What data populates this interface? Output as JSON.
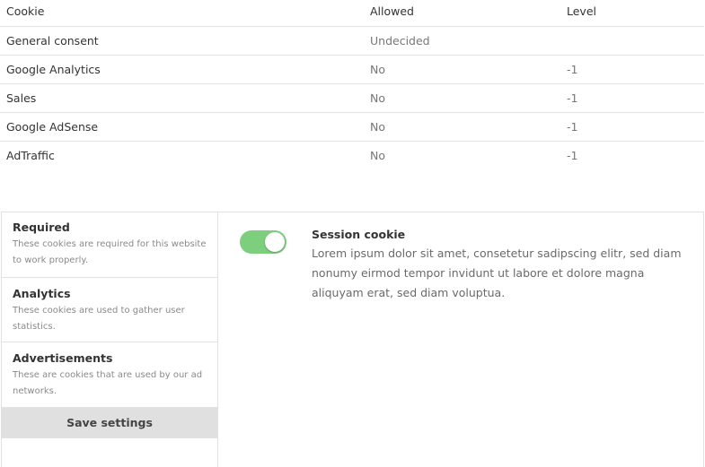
{
  "table": {
    "headers": {
      "cookie": "Cookie",
      "allowed": "Allowed",
      "level": "Level"
    },
    "rows": [
      {
        "name": "General consent",
        "allowed": "Undecided",
        "level": ""
      },
      {
        "name": "Google Analytics",
        "allowed": "No",
        "level": "-1"
      },
      {
        "name": "Sales",
        "allowed": "No",
        "level": "-1"
      },
      {
        "name": "Google AdSense",
        "allowed": "No",
        "level": "-1"
      },
      {
        "name": "AdTraffic",
        "allowed": "No",
        "level": "-1"
      }
    ]
  },
  "settings": {
    "categories": [
      {
        "title": "Required",
        "description": "These cookies are required for this website to work properly."
      },
      {
        "title": "Analytics",
        "description": "These cookies are used to gather user statistics."
      },
      {
        "title": "Advertisements",
        "description": "These are cookies that are used by our ad networks."
      }
    ],
    "save_label": "Save settings",
    "detail": {
      "toggle_on": true,
      "title": "Session cookie",
      "text": "Lorem ipsum dolor sit amet, consetetur sadipscing elitr, sed diam nonumy eirmod tempor invidunt ut labore et dolore magna aliquyam erat, sed diam voluptua."
    }
  },
  "colors": {
    "toggle_on": "#7dcf7d",
    "save_button_bg": "#e0e0e0",
    "border": "#e2e2e2"
  }
}
